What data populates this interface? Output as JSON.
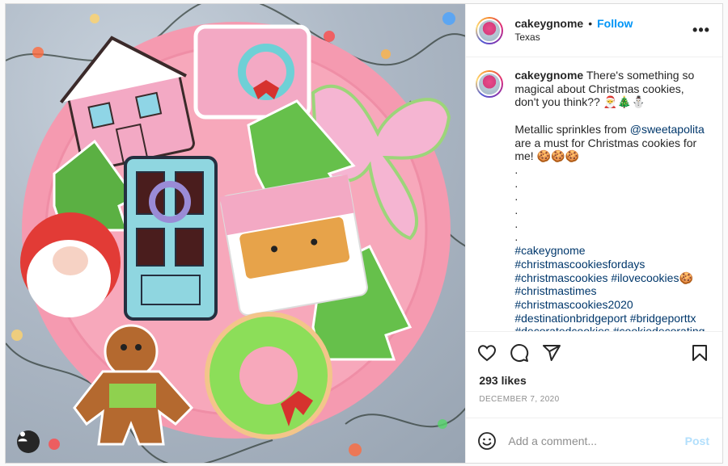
{
  "post": {
    "author": "cakeygnome",
    "location": "Texas",
    "follow_label": "Follow",
    "separator": "•",
    "more_label": "•••",
    "caption": {
      "username": "cakeygnome",
      "text": " There's something so magical about Christmas cookies, don't you think?? 🎅🎄⛄",
      "line2_prefix": "Metallic sprinkles from ",
      "mention": "@sweetapolita",
      "line2_suffix": " are a must for Christmas cookies for me! 🍪🍪🍪",
      "dots": [
        ".",
        ".",
        ".",
        ".",
        ".",
        "."
      ],
      "hashtags": [
        "#cakeygnome",
        "#christmascookiesfordays",
        "#christmascookies #ilovecookies🍪",
        "#christmastimes",
        "#christmascookies2020",
        "#destinationbridgeport #bridgeporttx",
        "#decoratedcookies #cookiedecorating"
      ]
    },
    "likes": "293 likes",
    "date": "DECEMBER 7, 2020",
    "comment_placeholder": "Add a comment...",
    "post_button": "Post",
    "colors": {
      "link": "#00376b",
      "follow": "#0095f6",
      "post_disabled": "#b2dffc"
    },
    "icons": {
      "like": "heart-icon",
      "comment": "comment-icon",
      "share": "share-icon",
      "save": "bookmark-icon",
      "emoji": "emoji-icon",
      "tag": "user-tag-icon"
    }
  }
}
